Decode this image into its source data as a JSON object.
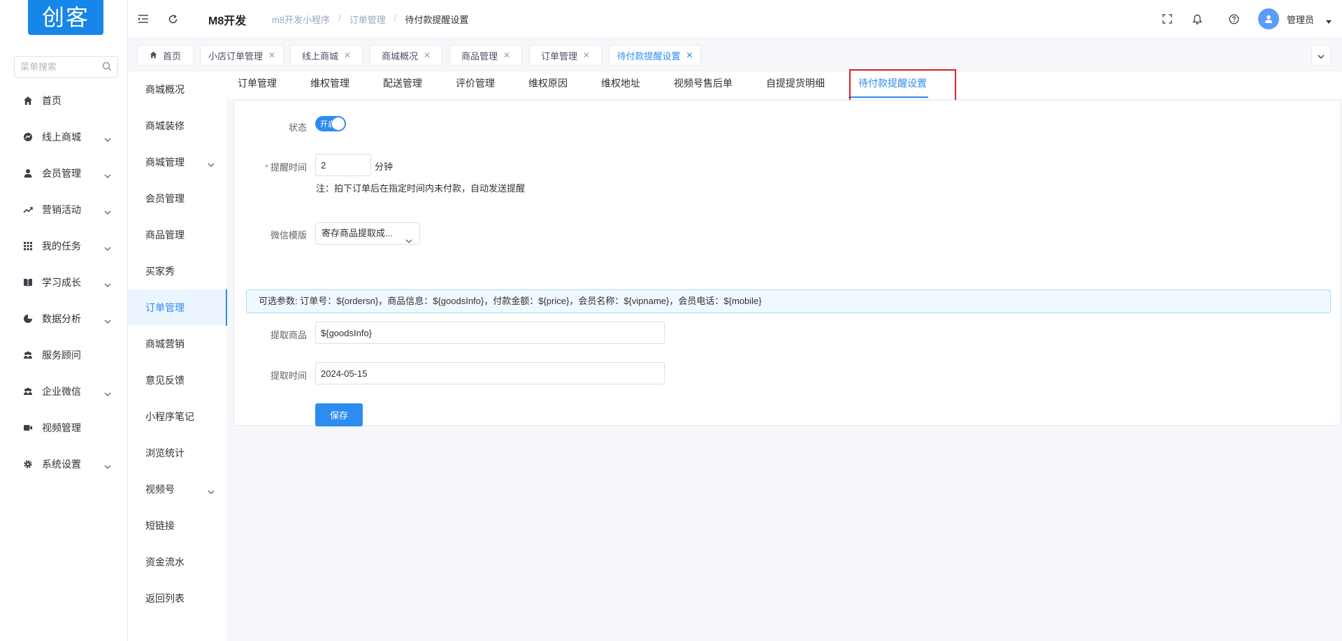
{
  "brand": {
    "logo_text": "创客"
  },
  "sidebar": {
    "search_placeholder": "菜单搜索",
    "items": [
      {
        "label": "首页",
        "icon": "home-icon"
      },
      {
        "label": "线上商城",
        "icon": "shop-icon"
      },
      {
        "label": "会员管理",
        "icon": "user-icon"
      },
      {
        "label": "营销活动",
        "icon": "trend-icon"
      },
      {
        "label": "我的任务",
        "icon": "grid-icon"
      },
      {
        "label": "学习成长",
        "icon": "book-icon"
      },
      {
        "label": "数据分析",
        "icon": "pie-icon"
      },
      {
        "label": "服务顾问",
        "icon": "people-icon"
      },
      {
        "label": "企业微信",
        "icon": "people-icon"
      },
      {
        "label": "视频管理",
        "icon": "video-icon"
      },
      {
        "label": "系统设置",
        "icon": "gear-icon"
      }
    ]
  },
  "header": {
    "app_title": "M8开发",
    "breadcrumb": [
      "m8开发小程序",
      "订单管理",
      "待付款提醒设置"
    ],
    "user_name": "管理员"
  },
  "tabs": [
    {
      "label": "首页"
    },
    {
      "label": "小店订单管理"
    },
    {
      "label": "线上商城"
    },
    {
      "label": "商城概况"
    },
    {
      "label": "商品管理"
    },
    {
      "label": "订单管理"
    },
    {
      "label": "待付款提醒设置"
    }
  ],
  "subnav": [
    {
      "label": "商城概况"
    },
    {
      "label": "商城装修"
    },
    {
      "label": "商城管理"
    },
    {
      "label": "会员管理"
    },
    {
      "label": "商品管理"
    },
    {
      "label": "买家秀"
    },
    {
      "label": "订单管理"
    },
    {
      "label": "商城营销"
    },
    {
      "label": "意见反馈"
    },
    {
      "label": "小程序笔记"
    },
    {
      "label": "浏览统计"
    },
    {
      "label": "视频号"
    },
    {
      "label": "短链接"
    },
    {
      "label": "资金流水"
    },
    {
      "label": "返回列表"
    }
  ],
  "topnav": [
    {
      "label": "订单管理"
    },
    {
      "label": "维权管理"
    },
    {
      "label": "配送管理"
    },
    {
      "label": "评价管理"
    },
    {
      "label": "维权原因"
    },
    {
      "label": "维权地址"
    },
    {
      "label": "视频号售后单"
    },
    {
      "label": "自提提货明细"
    },
    {
      "label": "待付款提醒设置"
    }
  ],
  "form": {
    "status_label": "状态",
    "status_switch_text": "开启",
    "remind_label": "提醒时间",
    "remind_value": "2",
    "remind_unit": "分钟",
    "remind_note": "注：拍下订单后在指定时间内未付款，自动发送提醒",
    "template_label": "微信模版",
    "template_value": "寄存商品提取成...",
    "params_note": "可选参数: 订单号：${ordersn}，商品信息：${goodsInfo}，付款金额：${price}，会员名称：${vipname}，会员电话：${mobile}",
    "goods_label": "提取商品",
    "goods_value": "${goodsInfo}",
    "time_label": "提取时间",
    "time_value": "2024-05-15",
    "save_label": "保存"
  },
  "colors": {
    "primary": "#2d8cf0",
    "logo_bg": "#1686e8",
    "highlight": "#e02020"
  }
}
